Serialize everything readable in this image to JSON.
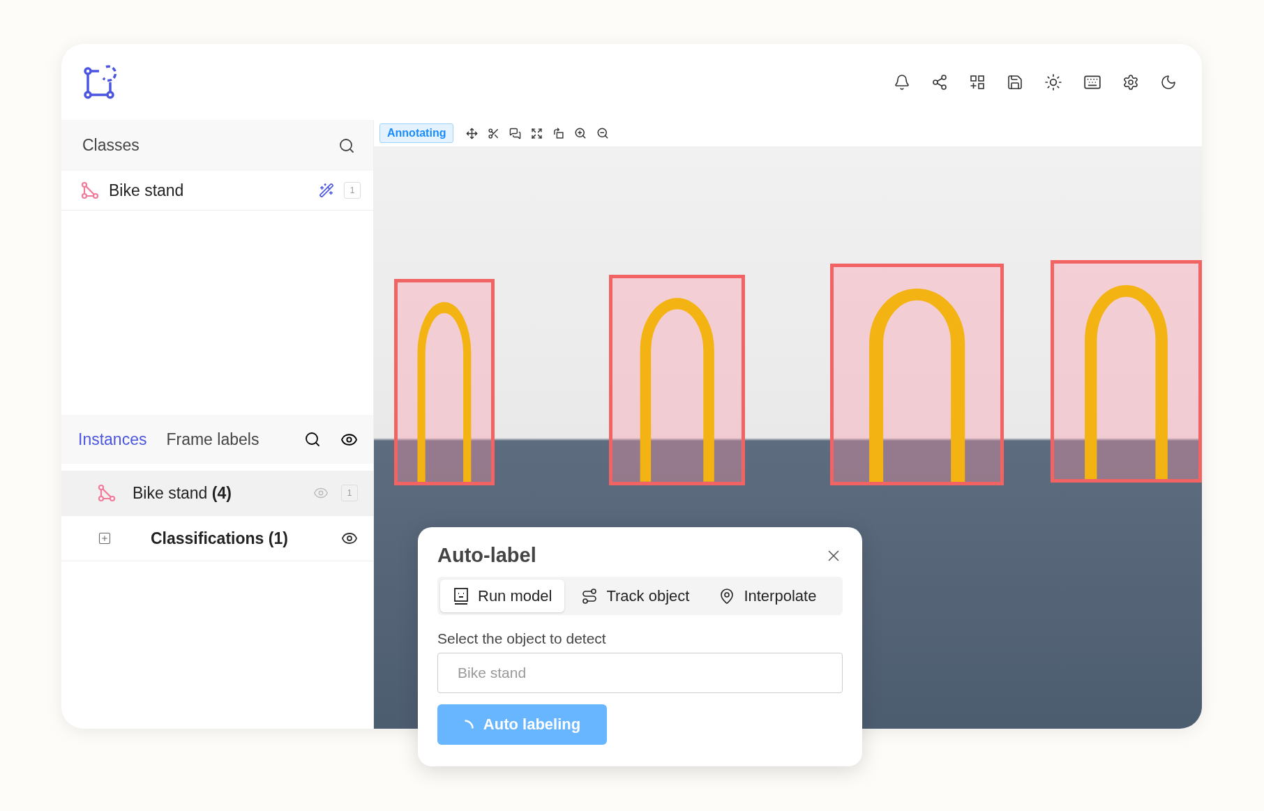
{
  "toolbar": {
    "mode": "Annotating"
  },
  "classes": {
    "title": "Classes",
    "items": [
      {
        "name": "Bike stand",
        "count": "1"
      }
    ]
  },
  "instances": {
    "tabs": [
      {
        "label": "Instances",
        "selected": true
      },
      {
        "label": "Frame labels",
        "selected": false
      }
    ],
    "items": [
      {
        "kind": "instance",
        "label": "Bike stand **(4)**",
        "count": "1",
        "selected": true
      },
      {
        "kind": "group",
        "label": "Classifications (1)",
        "expanded": false,
        "selected": false
      }
    ]
  },
  "dialog": {
    "title": "Auto-label",
    "tabs": [
      {
        "label": "Run model",
        "selected": true
      },
      {
        "label": "Track object",
        "selected": false
      },
      {
        "label": "Interpolate",
        "selected": false
      }
    ],
    "field_label": "Select the object to detect",
    "field": {
      "placeholder": "Bike stand"
    },
    "button": {
      "label": "Auto labeling",
      "loading": true
    }
  }
}
